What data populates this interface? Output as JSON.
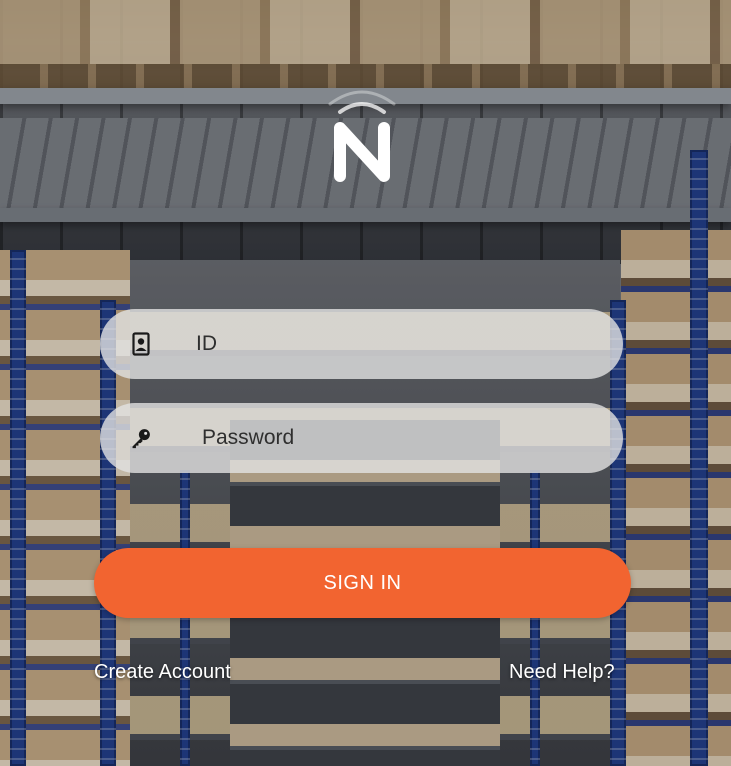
{
  "brand": {
    "logo_letter": "N"
  },
  "login": {
    "id_field": {
      "placeholder": "ID",
      "value": "",
      "icon": "id-card-icon"
    },
    "password_field": {
      "placeholder": "Password",
      "value": "",
      "icon": "key-icon"
    },
    "sign_in_label": "SIGN IN"
  },
  "links": {
    "create_account": "Create Account",
    "need_help": "Need Help?"
  },
  "colors": {
    "accent": "#f26430",
    "field_bg": "#e2e2e2",
    "text_light": "#ffffff"
  }
}
